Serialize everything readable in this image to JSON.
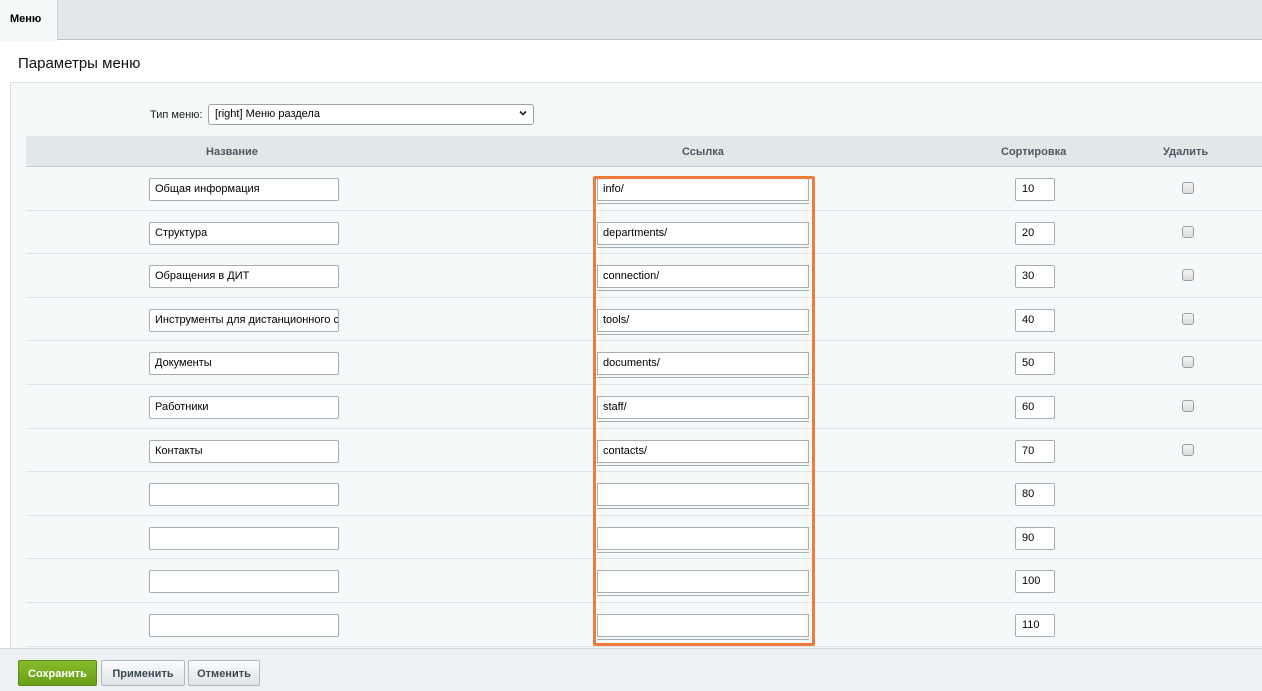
{
  "tabs": [
    {
      "label": "Меню"
    }
  ],
  "page_title": "Параметры меню",
  "menu_type": {
    "label": "Тип меню:",
    "selected": "[right] Меню раздела"
  },
  "columns": {
    "name": "Название",
    "link": "Ссылка",
    "sort": "Сортировка",
    "delete": "Удалить"
  },
  "rows": [
    {
      "name": "Общая информация",
      "link": "info/",
      "sort": "10",
      "deletable": true
    },
    {
      "name": "Структура",
      "link": "departments/",
      "sort": "20",
      "deletable": true
    },
    {
      "name": "Обращения в ДИТ",
      "link": "connection/",
      "sort": "30",
      "deletable": true
    },
    {
      "name": "Инструменты для дистанционного с",
      "link": "tools/",
      "sort": "40",
      "deletable": true
    },
    {
      "name": "Документы",
      "link": "documents/",
      "sort": "50",
      "deletable": true
    },
    {
      "name": "Работники",
      "link": "staff/",
      "sort": "60",
      "deletable": true
    },
    {
      "name": "Контакты",
      "link": "contacts/",
      "sort": "70",
      "deletable": true
    },
    {
      "name": "",
      "link": "",
      "sort": "80",
      "deletable": false
    },
    {
      "name": "",
      "link": "",
      "sort": "90",
      "deletable": false
    },
    {
      "name": "",
      "link": "",
      "sort": "100",
      "deletable": false
    },
    {
      "name": "",
      "link": "",
      "sort": "110",
      "deletable": false
    }
  ],
  "buttons": {
    "save": "Сохранить",
    "apply": "Применить",
    "cancel": "Отменить"
  },
  "colors": {
    "highlight": "#f07c3c",
    "save_button": "#78ad20"
  },
  "icons": {
    "select_arrow": "chevron-down-icon"
  }
}
